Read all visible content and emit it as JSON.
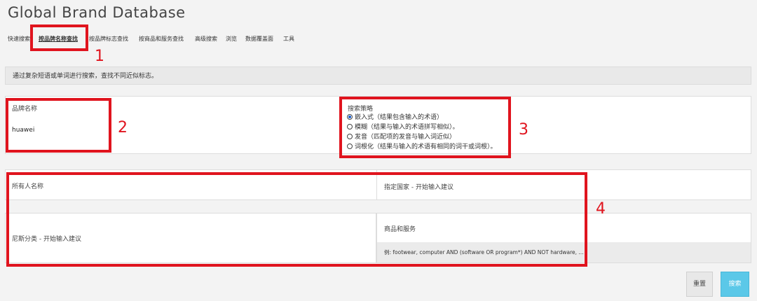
{
  "header": {
    "title": "Global Brand Database"
  },
  "tabs": [
    {
      "label": "快速搜索"
    },
    {
      "label": "按品牌名称查找",
      "active": true
    },
    {
      "label": "按品牌标志查找"
    },
    {
      "label": "按商品和服务查找"
    },
    {
      "label": "高级搜索"
    },
    {
      "label": "浏览"
    },
    {
      "label": "数据覆盖面"
    },
    {
      "label": "工具"
    }
  ],
  "info_text": "通过复杂短语或单词进行搜索，查找不同近似标志。",
  "brand_name": {
    "label": "品牌名称",
    "value": "huawei"
  },
  "strategy": {
    "label": "搜索策略",
    "options": [
      {
        "label": "嵌入式（结果包含输入的术语）",
        "selected": true
      },
      {
        "label": "模糊（结果与输入的术语拼写相似）。",
        "selected": false
      },
      {
        "label": "发音（匹配项的发音与输入词近似）",
        "selected": false
      },
      {
        "label": "词根化（结果与输入的术语有相同的词干或词根）。",
        "selected": false
      }
    ]
  },
  "filters": {
    "owner_label": "所有人名称",
    "country_placeholder": "指定国家 - 开始输入建议",
    "nice_placeholder": "尼斯分类 - 开始输入建议",
    "goods_label": "商品和服务",
    "goods_example": "例: footwear, computer AND (software OR program*) AND NOT hardware, ..."
  },
  "buttons": {
    "reset": "重置",
    "search": "搜索"
  },
  "annotations": [
    "1",
    "2",
    "3",
    "4"
  ],
  "colors": {
    "highlight_red": "#e0141e",
    "search_button": "#5bc8e8",
    "radio_selected": "#1a5fd0"
  }
}
